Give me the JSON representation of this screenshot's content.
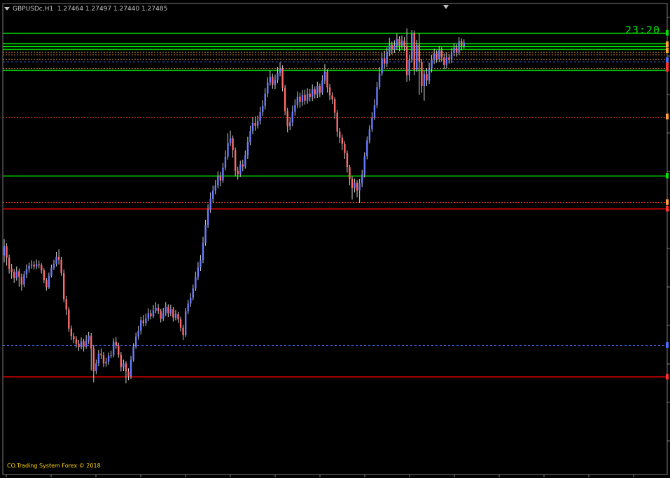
{
  "header": {
    "symbol": "GBPUSDc,H1",
    "ohlc": "1.27464 1.27497 1.27440 1.27485"
  },
  "clock": "23:20",
  "watermark": "CO.Trading System Forex © 2018",
  "colors": {
    "background": "#000000",
    "bull": "#6a7cff",
    "bear": "#ff6a6a",
    "green": "#00e000",
    "red": "#e00000",
    "orange": "#ffa040",
    "dotted_red": "#ff3030",
    "blue_dashed": "#4a6cff",
    "grid_tick": "#808080"
  },
  "chart_data": {
    "type": "candlestick",
    "x_range": [
      0,
      180
    ],
    "y_range": [
      0,
      100
    ],
    "candles": [
      [
        48.1,
        50.2,
        51.8,
        46.5
      ],
      [
        50.2,
        47.6,
        50.9,
        45.8
      ],
      [
        47.6,
        45.1,
        48.3,
        44.0
      ],
      [
        45.1,
        44.3,
        46.2,
        42.8
      ],
      [
        44.3,
        43.0,
        45.0,
        41.9
      ],
      [
        43.0,
        44.5,
        45.6,
        42.4
      ],
      [
        44.5,
        43.2,
        45.1,
        41.0
      ],
      [
        43.2,
        41.5,
        44.0,
        40.1
      ],
      [
        41.5,
        43.8,
        44.6,
        40.9
      ],
      [
        43.8,
        45.0,
        46.1,
        43.0
      ],
      [
        45.0,
        45.8,
        46.5,
        44.2
      ],
      [
        45.8,
        46.0,
        47.0,
        45.1
      ],
      [
        46.0,
        45.6,
        46.8,
        44.9
      ],
      [
        45.6,
        46.1,
        47.2,
        45.0
      ],
      [
        46.1,
        45.9,
        46.9,
        45.2
      ],
      [
        45.9,
        44.7,
        46.3,
        44.0
      ],
      [
        44.7,
        42.5,
        45.2,
        41.8
      ],
      [
        42.5,
        40.9,
        43.0,
        40.1
      ],
      [
        40.9,
        43.5,
        44.2,
        40.5
      ],
      [
        43.5,
        45.3,
        46.0,
        43.1
      ],
      [
        45.3,
        46.2,
        47.1,
        44.8
      ],
      [
        46.2,
        47.8,
        48.9,
        45.6
      ],
      [
        47.8,
        47.1,
        49.5,
        46.0
      ],
      [
        47.1,
        44.1,
        47.8,
        43.5
      ],
      [
        44.1,
        38.2,
        44.9,
        37.5
      ],
      [
        38.2,
        35.8,
        38.9,
        34.6
      ],
      [
        35.8,
        31.5,
        36.4,
        30.8
      ],
      [
        31.5,
        29.8,
        32.2,
        28.9
      ],
      [
        29.8,
        29.1,
        30.5,
        28.2
      ],
      [
        29.1,
        28.1,
        29.8,
        27.2
      ],
      [
        28.1,
        27.3,
        28.9,
        26.4
      ],
      [
        27.3,
        28.6,
        29.5,
        26.8
      ],
      [
        28.6,
        27.4,
        29.2,
        26.3
      ],
      [
        27.4,
        28.8,
        30.0,
        26.9
      ],
      [
        28.8,
        29.9,
        30.8,
        28.0
      ],
      [
        29.9,
        27.0,
        30.5,
        22.0
      ],
      [
        27.0,
        21.9,
        27.8,
        19.3
      ],
      [
        21.9,
        23.6,
        24.5,
        21.2
      ],
      [
        23.6,
        25.8,
        26.7,
        23.0
      ],
      [
        25.8,
        25.5,
        27.0,
        24.6
      ],
      [
        25.5,
        23.6,
        26.2,
        22.8
      ],
      [
        23.6,
        24.0,
        24.9,
        22.9
      ],
      [
        24.0,
        25.4,
        26.1,
        23.3
      ],
      [
        25.4,
        25.5,
        26.5,
        24.8
      ],
      [
        25.5,
        28.5,
        29.3,
        25.0
      ],
      [
        28.5,
        27.7,
        29.6,
        26.9
      ],
      [
        27.7,
        25.6,
        28.3,
        24.9
      ],
      [
        25.6,
        22.8,
        26.2,
        21.8
      ],
      [
        22.8,
        23.6,
        24.5,
        21.9
      ],
      [
        23.6,
        21.8,
        24.1,
        19.1
      ],
      [
        21.8,
        20.7,
        22.5,
        19.8
      ],
      [
        20.7,
        24.5,
        25.3,
        20.0
      ],
      [
        24.5,
        27.4,
        28.2,
        24.0
      ],
      [
        27.4,
        29.7,
        30.6,
        26.9
      ],
      [
        29.7,
        31.0,
        32.1,
        29.0
      ],
      [
        31.0,
        33.4,
        34.2,
        30.2
      ],
      [
        33.4,
        32.7,
        34.6,
        32.0
      ],
      [
        32.7,
        33.8,
        34.9,
        32.1
      ],
      [
        33.8,
        35.0,
        36.1,
        33.2
      ],
      [
        35.0,
        34.3,
        35.8,
        33.6
      ],
      [
        34.3,
        35.6,
        36.8,
        33.9
      ],
      [
        35.6,
        36.2,
        37.5,
        35.0
      ],
      [
        36.2,
        35.5,
        37.1,
        34.8
      ],
      [
        35.5,
        33.7,
        36.0,
        32.9
      ],
      [
        33.7,
        35.0,
        36.2,
        33.2
      ],
      [
        35.0,
        36.4,
        37.5,
        34.4
      ],
      [
        36.4,
        35.0,
        37.0,
        34.1
      ],
      [
        35.0,
        35.9,
        36.9,
        34.3
      ],
      [
        35.9,
        34.0,
        36.4,
        33.1
      ],
      [
        34.0,
        34.8,
        35.7,
        33.4
      ],
      [
        34.8,
        33.6,
        35.3,
        32.8
      ],
      [
        33.6,
        31.7,
        34.2,
        30.9
      ],
      [
        31.7,
        30.0,
        32.4,
        28.9
      ],
      [
        30.0,
        35.5,
        36.2,
        29.6
      ],
      [
        35.5,
        37.2,
        38.0,
        34.8
      ],
      [
        37.2,
        38.5,
        39.6,
        36.4
      ],
      [
        38.5,
        40.6,
        41.5,
        37.9
      ],
      [
        40.6,
        43.2,
        44.4,
        40.0
      ],
      [
        43.2,
        45.4,
        46.6,
        42.5
      ],
      [
        45.4,
        47.0,
        48.2,
        44.6
      ],
      [
        47.0,
        51.0,
        52.3,
        46.3
      ],
      [
        51.0,
        55.0,
        56.2,
        50.3
      ],
      [
        55.0,
        58.5,
        59.7,
        54.3
      ],
      [
        58.5,
        61.0,
        62.4,
        57.8
      ],
      [
        61.0,
        62.8,
        63.9,
        60.1
      ],
      [
        62.8,
        64.0,
        65.2,
        62.0
      ],
      [
        64.0,
        66.0,
        67.2,
        63.3
      ],
      [
        66.0,
        65.1,
        67.0,
        63.8
      ],
      [
        65.1,
        68.0,
        69.1,
        64.6
      ],
      [
        68.0,
        70.5,
        71.9,
        67.4
      ],
      [
        70.5,
        73.6,
        75.8,
        69.8
      ],
      [
        73.6,
        74.7,
        76.4,
        72.9
      ],
      [
        74.7,
        72.0,
        75.3,
        70.3
      ],
      [
        72.0,
        67.3,
        72.6,
        66.0
      ],
      [
        67.3,
        66.5,
        68.2,
        65.3
      ],
      [
        66.5,
        68.7,
        69.6,
        65.9
      ],
      [
        68.7,
        68.3,
        69.8,
        67.2
      ],
      [
        68.3,
        70.8,
        71.9,
        67.8
      ],
      [
        70.8,
        73.8,
        75.0,
        70.0
      ],
      [
        73.8,
        76.3,
        77.5,
        73.1
      ],
      [
        76.3,
        78.1,
        79.4,
        75.6
      ],
      [
        78.1,
        77.5,
        79.6,
        76.4
      ],
      [
        77.5,
        78.6,
        79.8,
        76.9
      ],
      [
        78.6,
        80.6,
        81.8,
        77.8
      ],
      [
        80.6,
        82.0,
        83.3,
        79.7
      ],
      [
        82.0,
        84.8,
        86.0,
        81.2
      ],
      [
        84.8,
        87.3,
        88.5,
        84.0
      ],
      [
        87.3,
        88.6,
        90.0,
        86.6
      ],
      [
        88.6,
        86.8,
        89.3,
        85.9
      ],
      [
        86.8,
        87.9,
        89.1,
        85.8
      ],
      [
        87.9,
        89.5,
        90.8,
        87.2
      ],
      [
        89.5,
        90.5,
        91.9,
        88.7
      ],
      [
        90.5,
        86.1,
        91.2,
        85.3
      ],
      [
        86.1,
        80.8,
        86.8,
        79.9
      ],
      [
        80.8,
        77.4,
        81.6,
        76.0
      ],
      [
        77.4,
        78.3,
        79.5,
        76.5
      ],
      [
        78.3,
        80.7,
        82.1,
        77.4
      ],
      [
        80.7,
        82.2,
        83.5,
        79.8
      ],
      [
        82.2,
        84.1,
        85.3,
        81.5
      ],
      [
        84.1,
        82.9,
        85.0,
        81.6
      ],
      [
        82.9,
        84.5,
        85.6,
        82.0
      ],
      [
        84.5,
        83.2,
        85.7,
        82.3
      ],
      [
        83.2,
        84.8,
        86.0,
        82.5
      ],
      [
        84.8,
        84.0,
        85.9,
        83.0
      ],
      [
        84.0,
        85.8,
        86.9,
        83.1
      ],
      [
        85.8,
        84.6,
        86.4,
        83.7
      ],
      [
        84.6,
        86.5,
        87.5,
        83.8
      ],
      [
        86.5,
        85.0,
        87.1,
        84.0
      ],
      [
        85.0,
        87.8,
        89.0,
        84.5
      ],
      [
        87.8,
        89.7,
        91.5,
        87.0
      ],
      [
        89.7,
        86.2,
        90.3,
        85.0
      ],
      [
        86.2,
        84.4,
        87.0,
        83.3
      ],
      [
        84.4,
        83.5,
        85.1,
        82.4
      ],
      [
        83.5,
        80.5,
        84.0,
        79.1
      ],
      [
        80.5,
        76.2,
        81.1,
        75.0
      ],
      [
        76.2,
        74.8,
        77.0,
        73.6
      ],
      [
        74.8,
        73.4,
        75.5,
        72.0
      ],
      [
        73.4,
        71.3,
        74.0,
        70.0
      ],
      [
        71.3,
        68.1,
        71.9,
        66.9
      ],
      [
        68.1,
        65.4,
        68.6,
        64.0
      ],
      [
        65.4,
        63.4,
        66.0,
        60.8
      ],
      [
        63.4,
        64.6,
        65.5,
        62.4
      ],
      [
        64.6,
        62.8,
        65.2,
        61.3
      ],
      [
        62.8,
        64.5,
        65.4,
        60.0
      ],
      [
        64.5,
        66.4,
        67.5,
        63.6
      ],
      [
        66.4,
        70.6,
        71.5,
        65.8
      ],
      [
        70.6,
        74.2,
        75.1,
        69.9
      ],
      [
        74.2,
        76.7,
        77.6,
        73.5
      ],
      [
        76.7,
        79.4,
        80.6,
        76.1
      ],
      [
        79.4,
        82.2,
        83.5,
        78.8
      ],
      [
        82.2,
        86.3,
        87.5,
        81.5
      ],
      [
        86.3,
        89.4,
        90.8,
        85.7
      ],
      [
        89.4,
        92.8,
        94.0,
        88.8
      ],
      [
        92.8,
        91.6,
        94.5,
        90.5
      ],
      [
        91.6,
        94.1,
        95.3,
        90.8
      ],
      [
        94.1,
        95.9,
        97.5,
        93.3
      ],
      [
        95.9,
        94.8,
        96.6,
        93.7
      ],
      [
        94.8,
        95.6,
        96.9,
        94.0
      ],
      [
        95.6,
        97.2,
        98.4,
        94.7
      ],
      [
        97.2,
        95.7,
        97.8,
        94.4
      ],
      [
        95.7,
        96.8,
        98.0,
        95.0
      ],
      [
        96.8,
        95.5,
        97.6,
        94.4
      ],
      [
        95.5,
        89.0,
        99.6,
        87.5
      ],
      [
        89.0,
        92.5,
        93.6,
        87.7
      ],
      [
        92.5,
        98.5,
        99.2,
        91.8
      ],
      [
        98.5,
        90.2,
        99.1,
        89.0
      ],
      [
        90.2,
        95.9,
        97.0,
        89.7
      ],
      [
        95.9,
        92.0,
        98.4,
        84.5
      ],
      [
        92.0,
        86.5,
        92.6,
        85.0
      ],
      [
        86.5,
        89.2,
        90.0,
        83.2
      ],
      [
        89.2,
        87.8,
        90.6,
        86.5
      ],
      [
        87.8,
        90.5,
        91.8,
        87.0
      ],
      [
        90.5,
        92.4,
        93.6,
        89.6
      ],
      [
        92.4,
        93.9,
        95.0,
        91.5
      ],
      [
        93.9,
        92.7,
        94.6,
        91.8
      ],
      [
        92.7,
        94.6,
        95.6,
        91.9
      ],
      [
        94.6,
        93.0,
        95.3,
        92.1
      ],
      [
        93.0,
        91.3,
        93.9,
        90.3
      ],
      [
        91.3,
        93.0,
        94.1,
        90.5
      ],
      [
        93.0,
        92.4,
        93.8,
        91.6
      ],
      [
        92.4,
        94.0,
        95.1,
        91.7
      ],
      [
        94.0,
        95.2,
        96.2,
        93.3
      ],
      [
        95.2,
        94.1,
        96.0,
        93.2
      ],
      [
        94.1,
        96.7,
        97.6,
        93.6
      ],
      [
        96.7,
        95.6,
        97.3,
        94.6
      ],
      [
        95.6,
        96.4,
        97.1,
        95.0
      ]
    ],
    "levels": [
      {
        "y": 98.6,
        "kind": "green-solid"
      },
      {
        "y": 96.2,
        "kind": "green-solid"
      },
      {
        "y": 95.6,
        "kind": "green-solid"
      },
      {
        "y": 95.0,
        "kind": "green-solid"
      },
      {
        "y": 94.3,
        "kind": "orange-dotted"
      },
      {
        "y": 93.6,
        "kind": "orange-dotted"
      },
      {
        "y": 92.7,
        "kind": "orange-dotted"
      },
      {
        "y": 92.0,
        "kind": "blue-dashed"
      },
      {
        "y": 90.7,
        "kind": "orange-dotted"
      },
      {
        "y": 90.2,
        "kind": "green-solid"
      },
      {
        "y": 79.6,
        "kind": "red-dotted"
      },
      {
        "y": 66.2,
        "kind": "green-solid"
      },
      {
        "y": 60.2,
        "kind": "red-dotted"
      },
      {
        "y": 58.7,
        "kind": "red-solid"
      },
      {
        "y": 27.8,
        "kind": "blue-dashed"
      },
      {
        "y": 20.6,
        "kind": "red-solid"
      }
    ],
    "right_markers": [
      {
        "y": 98.6,
        "color": "#00e000"
      },
      {
        "y": 96.0,
        "color": "#ffa040"
      },
      {
        "y": 94.6,
        "color": "#ffa040"
      },
      {
        "y": 92.4,
        "color": "#4a6cff"
      },
      {
        "y": 91.2,
        "color": "#ff3030"
      },
      {
        "y": 90.4,
        "color": "#ff3030"
      },
      {
        "y": 79.6,
        "color": "#ffa040"
      },
      {
        "y": 66.2,
        "color": "#00e000"
      },
      {
        "y": 60.2,
        "color": "#ffa040"
      },
      {
        "y": 58.7,
        "color": "#ff3030"
      },
      {
        "y": 27.8,
        "color": "#4a6cff"
      },
      {
        "y": 20.6,
        "color": "#ff3030"
      }
    ]
  }
}
